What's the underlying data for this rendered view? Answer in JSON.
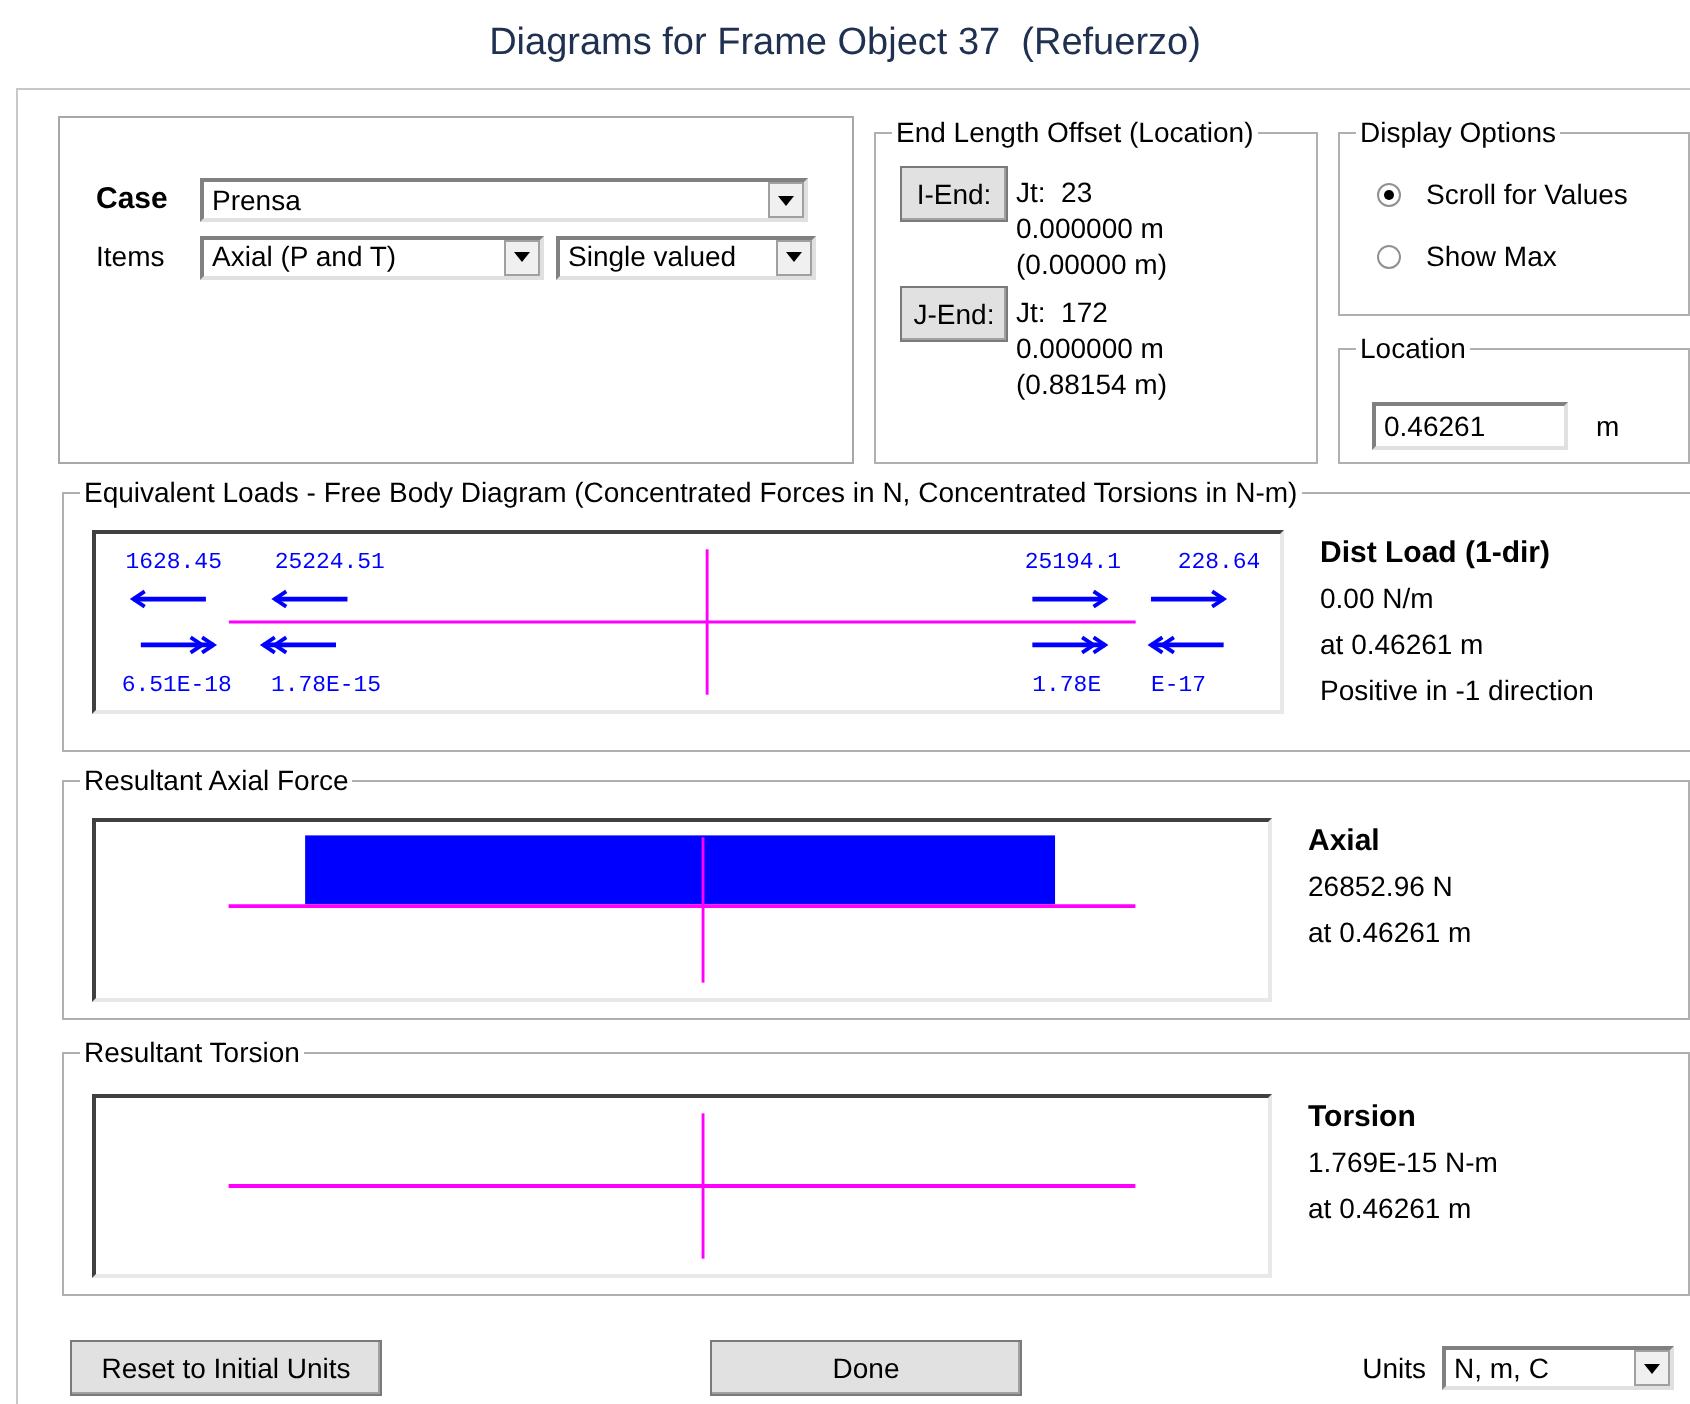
{
  "window": {
    "title": "Diagrams for Frame Object 37  (Refuerzo)"
  },
  "case_group": {
    "case_label": "Case",
    "case_value": "Prensa",
    "items_label": "Items",
    "items_value": "Axial (P and T)",
    "mode_value": "Single valued"
  },
  "end_offset": {
    "title": "End Length Offset (Location)",
    "ends": [
      {
        "button": "I-End:",
        "joint": "Jt:  23",
        "offset": "0.000000 m",
        "location": "(0.00000 m)"
      },
      {
        "button": "J-End:",
        "joint": "Jt:  172",
        "offset": "0.000000 m",
        "location": "(0.88154 m)"
      }
    ]
  },
  "display_options": {
    "title": "Display Options",
    "options": [
      {
        "label": "Scroll for Values",
        "selected": true
      },
      {
        "label": "Show Max",
        "selected": false
      }
    ]
  },
  "location": {
    "title": "Location",
    "value": "0.46261",
    "unit": "m"
  },
  "free_body": {
    "title": "Equivalent Loads - Free Body Diagram  (Concentrated Forces in N, Concentrated Torsions in N-m)",
    "force_labels": [
      "1628.45",
      "25224.51",
      "25194.1",
      "228.64"
    ],
    "torsion_labels": [
      "6.51E-18",
      "1.78E-15",
      "1.78E",
      "E-17"
    ],
    "info": {
      "heading": "Dist Load (1-dir)",
      "value": "0.00 N/m",
      "at": "at 0.46261 m",
      "note": "Positive in -1 direction"
    }
  },
  "axial": {
    "title": "Resultant Axial Force",
    "heading": "Axial",
    "value": "26852.96 N",
    "at": "at 0.46261 m"
  },
  "torsion": {
    "title": "Resultant Torsion",
    "heading": "Torsion",
    "value": "1.769E-15 N-m",
    "at": "at 0.46261 m"
  },
  "buttons": {
    "reset": "Reset to Initial Units",
    "done": "Done",
    "units_label": "Units",
    "units_value": "N, m, C"
  }
}
